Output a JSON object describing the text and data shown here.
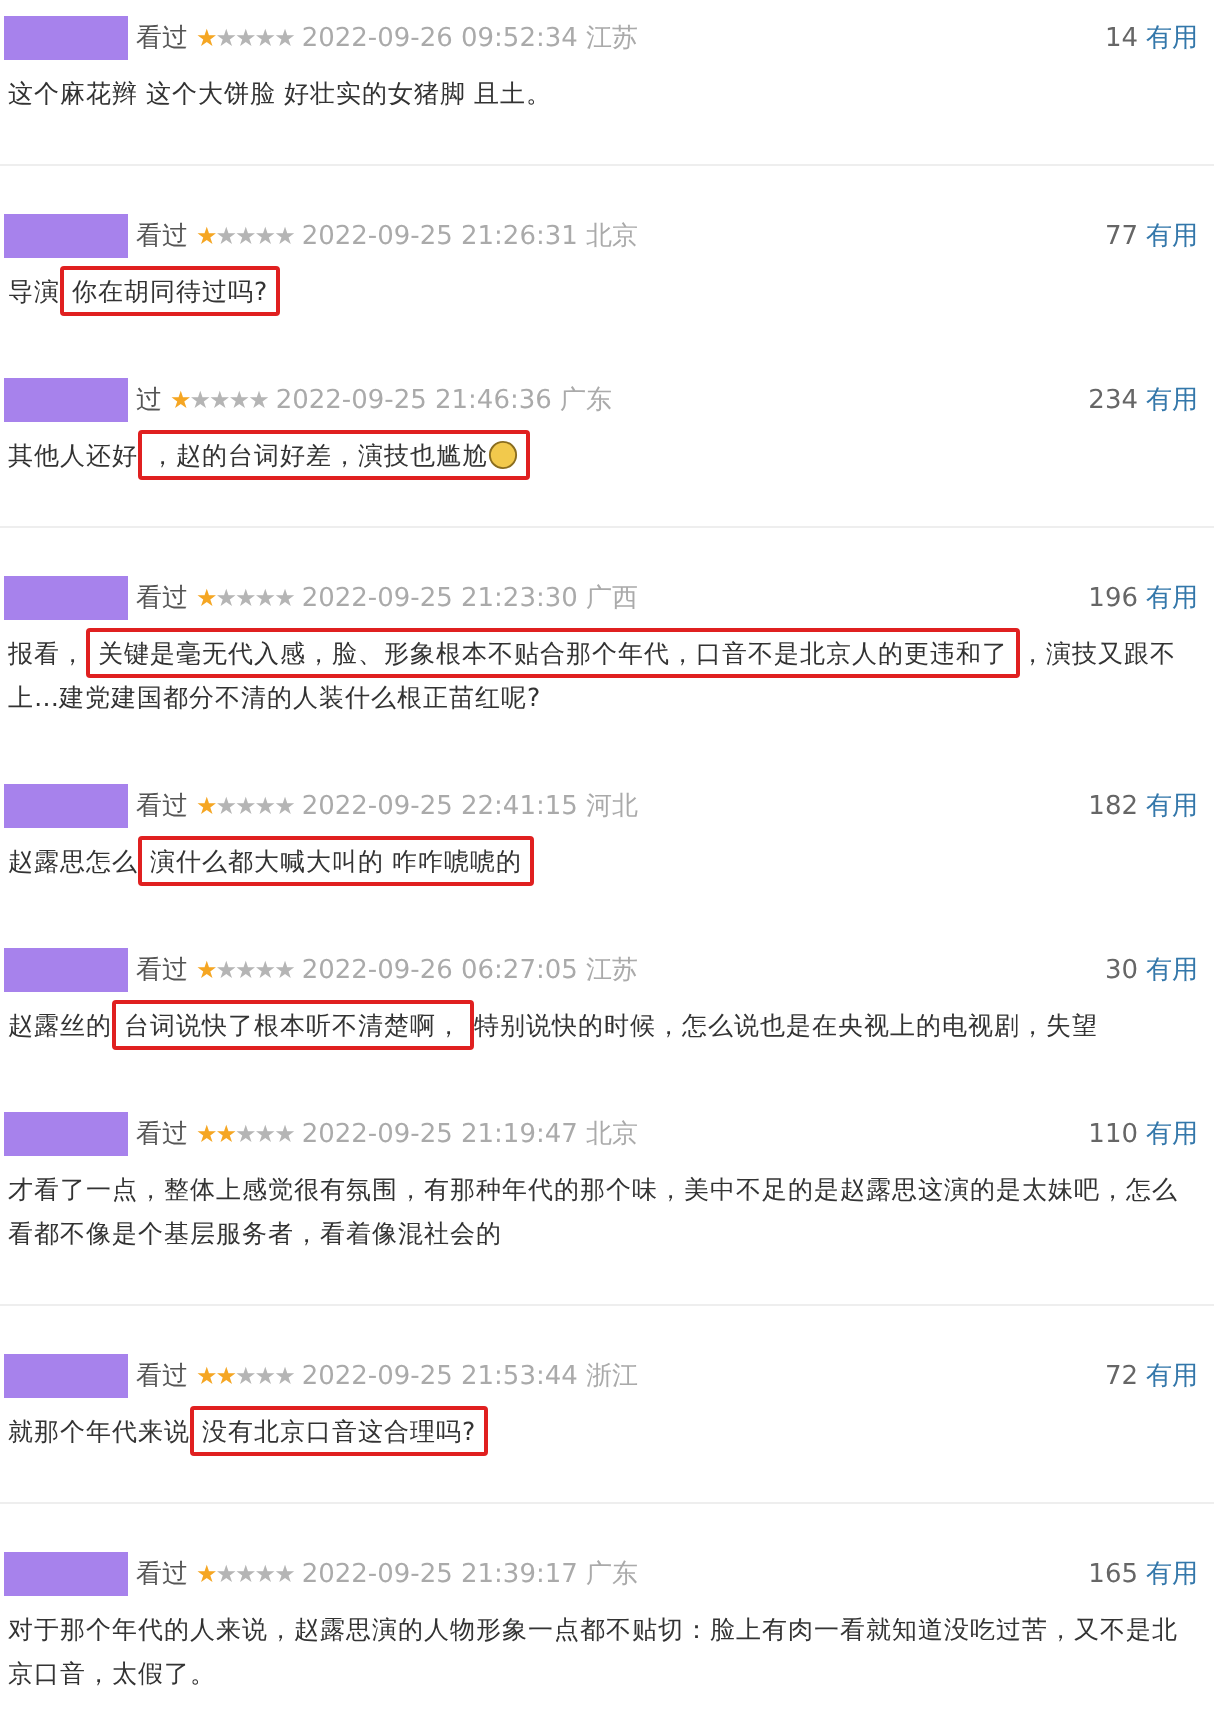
{
  "comments": [
    {
      "watched": "看过",
      "stars": 1,
      "time": "2022-09-26 09:52:34",
      "region": "江苏",
      "votes": "14",
      "useful": "有用",
      "before": "这个麻花辫 这个大饼脸 好壮实的女猪脚 且土。",
      "divider": true
    },
    {
      "watched": "看过",
      "stars": 1,
      "time": "2022-09-25 21:26:31",
      "region": "北京",
      "votes": "77",
      "useful": "有用",
      "before": "导演",
      "boxed": "你在胡同待过吗?",
      "divider": false
    },
    {
      "watched": "过",
      "stars": 1,
      "time": "2022-09-25 21:46:36",
      "region": "广东",
      "votes": "234",
      "useful": "有用",
      "before": "其他人还好",
      "boxed": "，赵的台词好差，演技也尴尬",
      "emoji": true,
      "divider": true
    },
    {
      "watched": "看过",
      "stars": 1,
      "time": "2022-09-25 21:23:30",
      "region": "广西",
      "votes": "196",
      "useful": "有用",
      "before": "报看，",
      "boxed": "关键是毫无代入感，脸、形象根本不贴合那个年代，口音不是北京人的更违和了",
      "after": "，演技又跟不上…建党建国都分不清的人装什么根正苗红呢?",
      "divider": false
    },
    {
      "watched": "看过",
      "stars": 1,
      "time": "2022-09-25 22:41:15",
      "region": "河北",
      "votes": "182",
      "useful": "有用",
      "before": "赵露思怎么",
      "boxed": "演什么都大喊大叫的 咋咋唬唬的",
      "divider": false
    },
    {
      "watched": "看过",
      "stars": 1,
      "time": "2022-09-26 06:27:05",
      "region": "江苏",
      "votes": "30",
      "useful": "有用",
      "before": "赵露丝的",
      "boxed": "台词说快了根本听不清楚啊，",
      "after": "特别说快的时候，怎么说也是在央视上的电视剧，失望",
      "divider": false
    },
    {
      "watched": "看过",
      "stars": 2,
      "time": "2022-09-25 21:19:47",
      "region": "北京",
      "votes": "110",
      "useful": "有用",
      "before": "才看了一点，整体上感觉很有氛围，有那种年代的那个味，美中不足的是赵露思这演的是太妹吧，怎么看都不像是个基层服务者，看着像混社会的",
      "divider": true
    },
    {
      "watched": "看过",
      "stars": 2,
      "time": "2022-09-25 21:53:44",
      "region": "浙江",
      "votes": "72",
      "useful": "有用",
      "before": "就那个年代来说",
      "boxed": "没有北京口音这合理吗?",
      "divider": true
    },
    {
      "watched": "看过",
      "stars": 1,
      "time": "2022-09-25 21:39:17",
      "region": "广东",
      "votes": "165",
      "useful": "有用",
      "before": "对于那个年代的人来说，赵露思演的人物形象一点都不贴切：脸上有肉一看就知道没吃过苦，又不是北京口音，太假了。",
      "divider": false
    }
  ]
}
